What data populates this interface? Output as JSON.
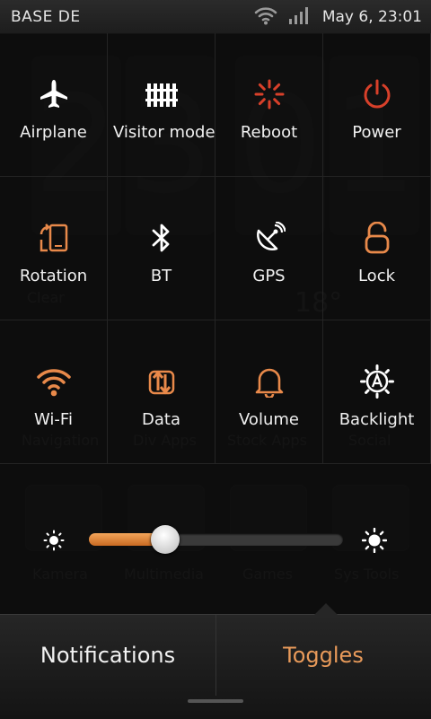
{
  "statusbar": {
    "carrier": "BASE DE",
    "datetime": "May 6, 23:01",
    "icons": [
      "wifi-icon",
      "signal-icon"
    ]
  },
  "background": {
    "clock_digits": [
      "2",
      "3",
      "0",
      "1"
    ],
    "weather_label": "Clear",
    "weather_temp": "18°",
    "folders": [
      "Navigation",
      "Div Apps",
      "Stock Apps",
      "Social",
      "Kamera",
      "Multimedia",
      "Games",
      "Sys Tools"
    ]
  },
  "toggles": [
    {
      "label": "Airplane",
      "icon": "airplane-icon",
      "color": "#ffffff"
    },
    {
      "label": "Visitor mode",
      "icon": "fence-icon",
      "color": "#ffffff"
    },
    {
      "label": "Reboot",
      "icon": "reboot-icon",
      "color": "#d8402a"
    },
    {
      "label": "Power",
      "icon": "power-icon",
      "color": "#d8402a"
    },
    {
      "label": "Rotation",
      "icon": "rotation-icon",
      "color": "#e8894a"
    },
    {
      "label": "BT",
      "icon": "bluetooth-icon",
      "color": "#ffffff"
    },
    {
      "label": "GPS",
      "icon": "gps-icon",
      "color": "#ffffff"
    },
    {
      "label": "Lock",
      "icon": "unlock-icon",
      "color": "#e8894a"
    },
    {
      "label": "Wi-Fi",
      "icon": "wifi-icon",
      "color": "#e8894a"
    },
    {
      "label": "Data",
      "icon": "data-icon",
      "color": "#e8894a"
    },
    {
      "label": "Volume",
      "icon": "bell-icon",
      "color": "#e8894a"
    },
    {
      "label": "Backlight",
      "icon": "auto-brightness-icon",
      "color": "#ffffff"
    }
  ],
  "brightness": {
    "level": 0.3,
    "low_icon": "brightness-low-icon",
    "high_icon": "brightness-high-icon"
  },
  "tabs": {
    "notifications": "Notifications",
    "toggles": "Toggles",
    "active": "toggles"
  },
  "colors": {
    "accent": "#e89a5a",
    "danger": "#d8402a"
  }
}
